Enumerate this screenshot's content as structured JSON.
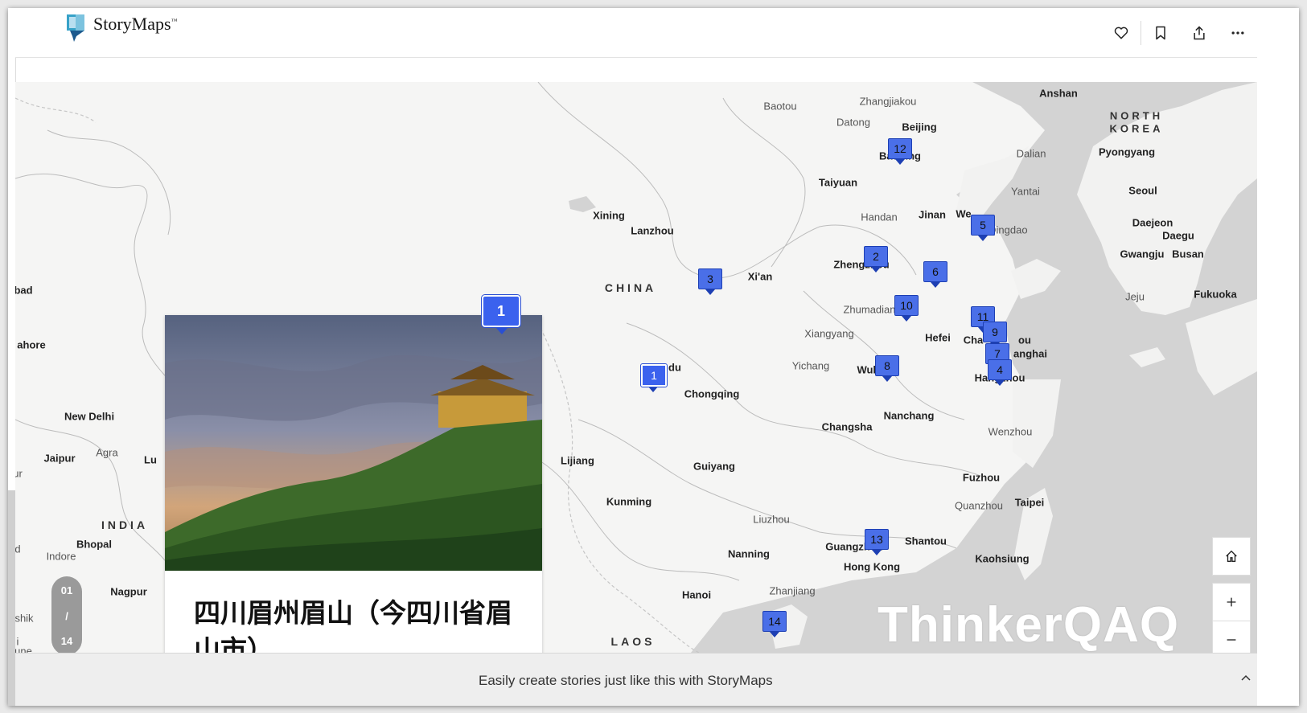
{
  "header": {
    "brand": "StoryMaps",
    "brand_tm": "™",
    "actions": [
      "heart-icon",
      "bookmark-icon",
      "share-icon",
      "more-icon"
    ]
  },
  "map": {
    "country_labels": [
      "CHINA",
      "INDIA",
      "LAOS",
      "NORTH",
      "KOREA"
    ],
    "cities": [
      {
        "name": "Anshan",
        "major": true
      },
      {
        "name": "Baotou",
        "major": false
      },
      {
        "name": "Zhangjiakou",
        "major": false
      },
      {
        "name": "Datong",
        "major": false
      },
      {
        "name": "Beijing",
        "major": true
      },
      {
        "name": "Baoding",
        "major": true
      },
      {
        "name": "Dalian",
        "major": false
      },
      {
        "name": "Pyongyang",
        "major": true
      },
      {
        "name": "Taiyuan",
        "major": true
      },
      {
        "name": "Yantai",
        "major": false
      },
      {
        "name": "Seoul",
        "major": true
      },
      {
        "name": "Xining",
        "major": true
      },
      {
        "name": "Lanzhou",
        "major": true
      },
      {
        "name": "Handan",
        "major": false
      },
      {
        "name": "Jinan",
        "major": true
      },
      {
        "name": "We",
        "major": true
      },
      {
        "name": "Qingdao",
        "major": false
      },
      {
        "name": "Daejeon",
        "major": true
      },
      {
        "name": "Daegu",
        "major": true
      },
      {
        "name": "Gwangju",
        "major": true
      },
      {
        "name": "Busan",
        "major": true
      },
      {
        "name": "Zhengzhou",
        "major": true
      },
      {
        "name": "Xi'an",
        "major": true
      },
      {
        "name": "Jeju",
        "major": false
      },
      {
        "name": "Fukuoka",
        "major": true
      },
      {
        "name": "Zhumadian",
        "major": false
      },
      {
        "name": "Xiangyang",
        "major": false
      },
      {
        "name": "Hefei",
        "major": true
      },
      {
        "name": "Cha",
        "major": true
      },
      {
        "name": "ou",
        "major": true
      },
      {
        "name": "anghai",
        "major": true
      },
      {
        "name": "Yichang",
        "major": false
      },
      {
        "name": "Wuhan",
        "major": true
      },
      {
        "name": "Hangzhou",
        "major": true
      },
      {
        "name": "du",
        "major": true
      },
      {
        "name": "Chongqing",
        "major": true
      },
      {
        "name": "Changsha",
        "major": true
      },
      {
        "name": "Nanchang",
        "major": true
      },
      {
        "name": "Wenzhou",
        "major": false
      },
      {
        "name": "Lijiang",
        "major": true
      },
      {
        "name": "Guiyang",
        "major": true
      },
      {
        "name": "Fuzhou",
        "major": true
      },
      {
        "name": "Kunming",
        "major": true
      },
      {
        "name": "Quanzhou",
        "major": false
      },
      {
        "name": "Taipei",
        "major": true
      },
      {
        "name": "Liuzhou",
        "major": false
      },
      {
        "name": "Shantou",
        "major": true
      },
      {
        "name": "Guangzhou",
        "major": true
      },
      {
        "name": "Nanning",
        "major": true
      },
      {
        "name": "Hong Kong",
        "major": true
      },
      {
        "name": "Kaohsiung",
        "major": true
      },
      {
        "name": "Zhanjiang",
        "major": false
      },
      {
        "name": "Hanoi",
        "major": true
      },
      {
        "name": "New Delhi",
        "major": true
      },
      {
        "name": "Jaipur",
        "major": true
      },
      {
        "name": "Agra",
        "major": false
      },
      {
        "name": "Lu",
        "major": true
      },
      {
        "name": "ahore",
        "major": true
      },
      {
        "name": "bad",
        "major": true
      },
      {
        "name": "Bhopal",
        "major": true
      },
      {
        "name": "Indore",
        "major": false
      },
      {
        "name": "Nagpur",
        "major": true
      },
      {
        "name": "ur",
        "major": false
      },
      {
        "name": "d",
        "major": false
      },
      {
        "name": "shik",
        "major": false
      },
      {
        "name": "i",
        "major": false
      },
      {
        "name": "une",
        "major": false
      }
    ],
    "markers": [
      "12",
      "2",
      "3",
      "6",
      "10",
      "5",
      "11",
      "9",
      "7",
      "4",
      "8",
      "1",
      "13",
      "14"
    ],
    "active_marker": "1"
  },
  "card": {
    "marker": "1",
    "title": "四川眉州眉山（今四川省眉山市）"
  },
  "pager": {
    "current": "01",
    "sep": "/",
    "total": "14"
  },
  "controls": [
    "home-icon",
    "zoom-in-icon",
    "zoom-out-icon"
  ],
  "watermark": "ThinkerQAQ",
  "footer": {
    "text": "Easily create stories just like this with StoryMaps"
  }
}
